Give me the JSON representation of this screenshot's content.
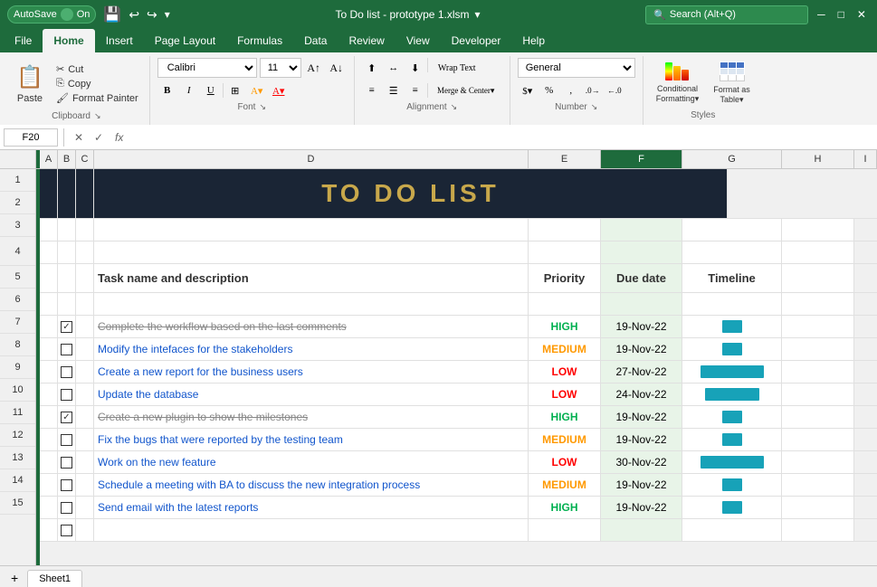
{
  "titleBar": {
    "autosave": "AutoSave",
    "autosave_on": "On",
    "title": "To Do list - prototype 1.xlsm",
    "search_placeholder": "Search (Alt+Q)"
  },
  "ribbon": {
    "tabs": [
      "File",
      "Home",
      "Insert",
      "Page Layout",
      "Formulas",
      "Data",
      "Review",
      "View",
      "Developer",
      "Help"
    ],
    "active_tab": "Home",
    "groups": {
      "clipboard": {
        "label": "Clipboard",
        "paste": "Paste",
        "cut": "Cut",
        "copy": "Copy",
        "format_painter": "Format Painter"
      },
      "font": {
        "label": "Font",
        "font_name": "Calibri",
        "font_size": "11"
      },
      "alignment": {
        "label": "Alignment",
        "wrap_text": "Wrap Text",
        "merge": "Merge & Center"
      },
      "number": {
        "label": "Number",
        "format": "General"
      },
      "styles": {
        "label": "Styles",
        "conditional": "Conditional Formatting",
        "format_as_table": "Format as Table"
      }
    }
  },
  "formulaBar": {
    "cell_ref": "F20",
    "fx_label": "fx"
  },
  "columns": {
    "headers": [
      "A",
      "B",
      "C",
      "D",
      "E",
      "F",
      "G",
      "H",
      "I"
    ],
    "selected": "F"
  },
  "spreadsheet": {
    "title": "TO DO LIST",
    "headers": {
      "task": "Task name and description",
      "priority": "Priority",
      "due_date": "Due date",
      "timeline": "Timeline"
    },
    "rows": [
      {
        "row": 6,
        "checked": true,
        "task": "Complete the workflow based on the last comments",
        "strikethrough": true,
        "priority": "HIGH",
        "priority_class": "priority-high",
        "due_date": "19-Nov-22",
        "timeline_width": 22
      },
      {
        "row": 7,
        "checked": false,
        "task": "Modify the intefaces for the stakeholders",
        "strikethrough": false,
        "priority": "MEDIUM",
        "priority_class": "priority-medium",
        "due_date": "19-Nov-22",
        "timeline_width": 22
      },
      {
        "row": 8,
        "checked": false,
        "task": "Create a new report for the business users",
        "strikethrough": false,
        "priority": "LOW",
        "priority_class": "priority-low",
        "due_date": "27-Nov-22",
        "timeline_width": 70
      },
      {
        "row": 9,
        "checked": false,
        "task": "Update the database",
        "strikethrough": false,
        "priority": "LOW",
        "priority_class": "priority-low",
        "due_date": "24-Nov-22",
        "timeline_width": 60
      },
      {
        "row": 10,
        "checked": true,
        "task": "Create a new plugin to show the milestones",
        "strikethrough": true,
        "priority": "HIGH",
        "priority_class": "priority-high",
        "due_date": "19-Nov-22",
        "timeline_width": 22
      },
      {
        "row": 11,
        "checked": false,
        "task": "Fix the bugs that were reported by the testing team",
        "strikethrough": false,
        "priority": "MEDIUM",
        "priority_class": "priority-medium",
        "due_date": "19-Nov-22",
        "timeline_width": 22
      },
      {
        "row": 12,
        "checked": false,
        "task": "Work on the new feature",
        "strikethrough": false,
        "priority": "LOW",
        "priority_class": "priority-low",
        "due_date": "30-Nov-22",
        "timeline_width": 70
      },
      {
        "row": 13,
        "checked": false,
        "task": "Schedule a meeting with BA to discuss the new integration process",
        "strikethrough": false,
        "priority": "MEDIUM",
        "priority_class": "priority-medium",
        "due_date": "19-Nov-22",
        "timeline_width": 22
      },
      {
        "row": 14,
        "checked": false,
        "task": "Send email with the latest reports",
        "strikethrough": false,
        "priority": "HIGH",
        "priority_class": "priority-high",
        "due_date": "19-Nov-22",
        "timeline_width": 22
      },
      {
        "row": 15,
        "checked": false,
        "task": "",
        "strikethrough": false,
        "priority": "",
        "priority_class": "",
        "due_date": "",
        "timeline_width": 0
      }
    ]
  },
  "sheetTabs": {
    "tabs": [
      "Sheet1"
    ],
    "active": "Sheet1"
  }
}
